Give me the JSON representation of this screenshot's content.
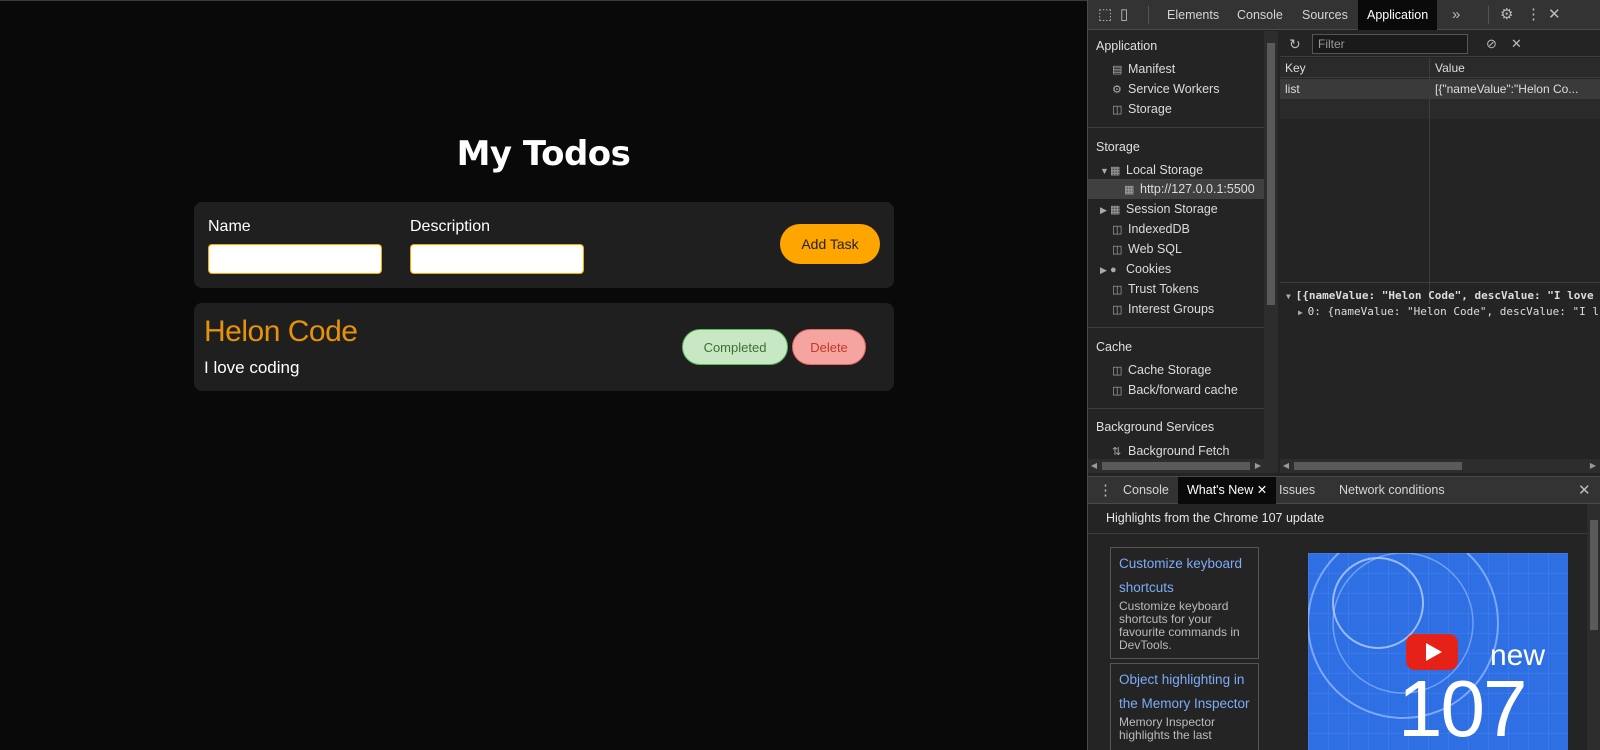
{
  "page": {
    "title": "My Todos",
    "form": {
      "name_label": "Name",
      "description_label": "Description",
      "name_value": "",
      "description_value": "",
      "add_button": "Add Task"
    },
    "task": {
      "name": "Helon Code",
      "description": "I love coding",
      "completed_button": "Completed",
      "delete_button": "Delete"
    },
    "colors": {
      "accent": "#ffa500",
      "task_name": "#e6920a",
      "completed": "#c7e8c2",
      "delete": "#f6a4a0"
    }
  },
  "devtools": {
    "tabs": [
      "Elements",
      "Console",
      "Sources",
      "Application"
    ],
    "active_tab": "Application",
    "sidebar": {
      "application_header": "Application",
      "application_items": [
        "Manifest",
        "Service Workers",
        "Storage"
      ],
      "storage_header": "Storage",
      "local_storage": "Local Storage",
      "local_storage_origin": "http://127.0.0.1:5500",
      "storage_items": [
        "Session Storage",
        "IndexedDB",
        "Web SQL",
        "Cookies",
        "Trust Tokens",
        "Interest Groups"
      ],
      "cache_header": "Cache",
      "cache_items": [
        "Cache Storage",
        "Back/forward cache"
      ],
      "background_header": "Background Services",
      "background_items": [
        "Background Fetch"
      ]
    },
    "storage_pane": {
      "filter_placeholder": "Filter",
      "columns": [
        "Key",
        "Value"
      ],
      "rows": [
        {
          "key": "list",
          "value": "[{\"nameValue\":\"Helon Co..."
        }
      ],
      "preview_line1": "[{nameValue: \"Helon Code\", descValue: \"I love",
      "preview_line2": "0: {nameValue: \"Helon Code\", descValue: \"I l"
    },
    "drawer": {
      "tabs": [
        "Console",
        "What's New",
        "Issues",
        "Network conditions"
      ],
      "active_tab": "What's New",
      "highlights": "Highlights from the Chrome 107 update",
      "cards": [
        {
          "title": "Customize keyboard shortcuts",
          "text": "Customize keyboard shortcuts for your favourite commands in DevTools."
        },
        {
          "title": "Object highlighting in the Memory Inspector",
          "text": "Memory Inspector highlights the last"
        }
      ],
      "promo_new": "new",
      "promo_version": "107"
    }
  }
}
